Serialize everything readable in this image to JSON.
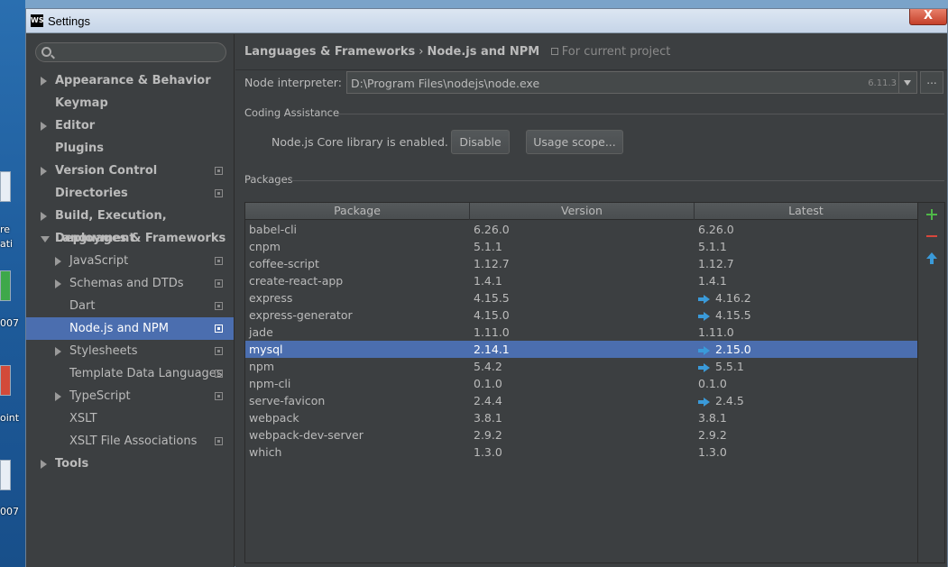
{
  "desktop": {
    "labels": [
      "re",
      "ati",
      "007",
      "oint",
      "007"
    ]
  },
  "window": {
    "title": "Settings",
    "logo": "WS",
    "close_symbol": "X"
  },
  "sidebar": {
    "items": [
      {
        "label": "Appearance & Behavior",
        "bold": true,
        "arrow": "right",
        "level": 0
      },
      {
        "label": "Keymap",
        "bold": true,
        "arrow": "none",
        "level": 0
      },
      {
        "label": "Editor",
        "bold": true,
        "arrow": "right",
        "level": 0
      },
      {
        "label": "Plugins",
        "bold": true,
        "arrow": "none",
        "level": 0
      },
      {
        "label": "Version Control",
        "bold": true,
        "arrow": "right",
        "level": 0,
        "project": true
      },
      {
        "label": "Directories",
        "bold": true,
        "arrow": "none",
        "level": 0,
        "project": true
      },
      {
        "label": "Build, Execution, Deployment",
        "bold": true,
        "arrow": "right",
        "level": 0
      },
      {
        "label": "Languages & Frameworks",
        "bold": true,
        "arrow": "down",
        "level": 0
      },
      {
        "label": "JavaScript",
        "bold": false,
        "arrow": "right",
        "level": 1,
        "project": true
      },
      {
        "label": "Schemas and DTDs",
        "bold": false,
        "arrow": "right",
        "level": 1,
        "project": true
      },
      {
        "label": "Dart",
        "bold": false,
        "arrow": "none",
        "level": 1,
        "project": true
      },
      {
        "label": "Node.js and NPM",
        "bold": false,
        "arrow": "none",
        "level": 1,
        "project": true,
        "selected": true
      },
      {
        "label": "Stylesheets",
        "bold": false,
        "arrow": "right",
        "level": 1,
        "project": true
      },
      {
        "label": "Template Data Languages",
        "bold": false,
        "arrow": "none",
        "level": 1,
        "project": true
      },
      {
        "label": "TypeScript",
        "bold": false,
        "arrow": "right",
        "level": 1,
        "project": true
      },
      {
        "label": "XSLT",
        "bold": false,
        "arrow": "none",
        "level": 1
      },
      {
        "label": "XSLT File Associations",
        "bold": false,
        "arrow": "none",
        "level": 1,
        "project": true
      },
      {
        "label": "Tools",
        "bold": true,
        "arrow": "right",
        "level": 0
      }
    ]
  },
  "main": {
    "breadcrumb": {
      "parent": "Languages & Frameworks",
      "separator": "›",
      "current": "Node.js and NPM",
      "scope": "For current project"
    },
    "interpreter": {
      "label": "Node interpreter:",
      "path": "D:\\Program Files\\nodejs\\node.exe",
      "version": "6.11.3",
      "browse_label": "..."
    },
    "coding_assistance": {
      "title": "Coding Assistance",
      "status": "Node.js Core library is enabled.",
      "disable_label": "Disable",
      "usage_scope_label": "Usage scope..."
    },
    "packages": {
      "title": "Packages",
      "columns": [
        "Package",
        "Version",
        "Latest"
      ],
      "rows": [
        {
          "name": "babel-cli",
          "version": "6.26.0",
          "latest": "6.26.0",
          "upgrade": false
        },
        {
          "name": "cnpm",
          "version": "5.1.1",
          "latest": "5.1.1",
          "upgrade": false
        },
        {
          "name": "coffee-script",
          "version": "1.12.7",
          "latest": "1.12.7",
          "upgrade": false
        },
        {
          "name": "create-react-app",
          "version": "1.4.1",
          "latest": "1.4.1",
          "upgrade": false
        },
        {
          "name": "express",
          "version": "4.15.5",
          "latest": "4.16.2",
          "upgrade": true
        },
        {
          "name": "express-generator",
          "version": "4.15.0",
          "latest": "4.15.5",
          "upgrade": true
        },
        {
          "name": "jade",
          "version": "1.11.0",
          "latest": "1.11.0",
          "upgrade": false
        },
        {
          "name": "mysql",
          "version": "2.14.1",
          "latest": "2.15.0",
          "upgrade": true,
          "selected": true
        },
        {
          "name": "npm",
          "version": "5.4.2",
          "latest": "5.5.1",
          "upgrade": true
        },
        {
          "name": "npm-cli",
          "version": "0.1.0",
          "latest": "0.1.0",
          "upgrade": false
        },
        {
          "name": "serve-favicon",
          "version": "2.4.4",
          "latest": "2.4.5",
          "upgrade": true
        },
        {
          "name": "webpack",
          "version": "3.8.1",
          "latest": "3.8.1",
          "upgrade": false
        },
        {
          "name": "webpack-dev-server",
          "version": "2.9.2",
          "latest": "2.9.2",
          "upgrade": false
        },
        {
          "name": "which",
          "version": "1.3.0",
          "latest": "1.3.0",
          "upgrade": false
        }
      ],
      "tools": [
        "add-icon",
        "remove-icon",
        "upgrade-icon"
      ]
    }
  },
  "colors": {
    "selection": "#4b6eaf",
    "upgrade_arrow": "#3a9ad9",
    "add": "#4fb848",
    "remove": "#d8473c"
  }
}
